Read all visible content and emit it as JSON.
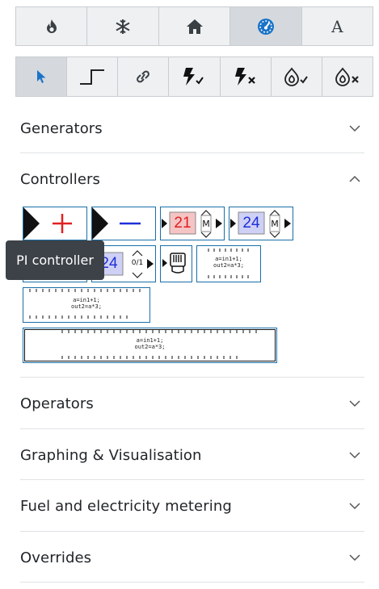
{
  "tabs": [
    {
      "icon": "fire-icon",
      "active": false
    },
    {
      "icon": "snowflake-icon",
      "active": false
    },
    {
      "icon": "home-icon",
      "active": false
    },
    {
      "icon": "gauge-icon",
      "active": true
    },
    {
      "icon": "text-icon",
      "label": "A",
      "active": false
    }
  ],
  "tools": [
    {
      "icon": "pointer-icon",
      "active": true
    },
    {
      "icon": "step-icon",
      "active": false
    },
    {
      "icon": "link-icon",
      "active": false
    },
    {
      "icon": "electricity-check-icon",
      "active": false
    },
    {
      "icon": "electricity-cross-icon",
      "active": false
    },
    {
      "icon": "fuel-check-icon",
      "active": false
    },
    {
      "icon": "fuel-cross-icon",
      "active": false
    }
  ],
  "sections": {
    "generators": "Generators",
    "controllers": "Controllers",
    "operators": "Operators",
    "graphing": "Graphing & Visualisation",
    "fuel": "Fuel and electricity metering",
    "overrides": "Overrides"
  },
  "controllers": {
    "setpoint_red": "21",
    "setpoint_blue": "24",
    "mode_label": "M",
    "pi_value": "24",
    "pi_range": "0/1",
    "code_line1": "a=in1+1;",
    "code_line2": "out2=a*3;"
  },
  "tooltip": "PI controller",
  "colors": {
    "accent_blue": "#1a73c8",
    "plus_red": "#e02020",
    "minus_blue": "#1f2fd8",
    "red_fill": "#f5c4c4",
    "blue_fill": "#cfd0f5"
  }
}
